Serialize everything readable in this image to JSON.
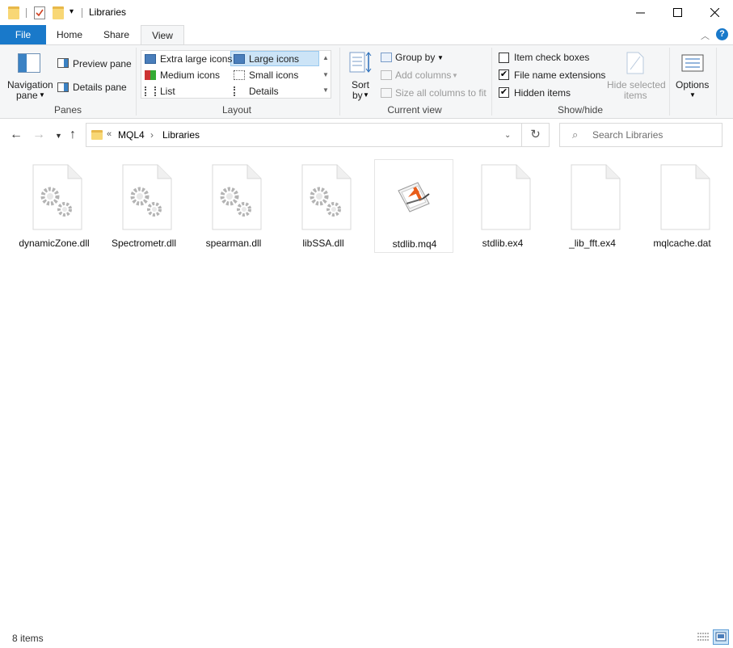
{
  "window": {
    "title": "Libraries"
  },
  "tabs": [
    "File",
    "Home",
    "Share",
    "View"
  ],
  "ribbon": {
    "panes": {
      "nav_pane_l1": "Navigation",
      "nav_pane_l2": "pane",
      "preview": "Preview pane",
      "details": "Details pane",
      "label": "Panes"
    },
    "layout": {
      "items": [
        "Extra large icons",
        "Large icons",
        "Medium icons",
        "Small icons",
        "List",
        "Details"
      ],
      "selected": "Large icons",
      "label": "Layout"
    },
    "current_view": {
      "sort_l1": "Sort",
      "sort_l2": "by",
      "group_by": "Group by",
      "add_columns": "Add columns",
      "size_columns": "Size all columns to fit",
      "label": "Current view"
    },
    "show_hide": {
      "item_check_boxes": "Item check boxes",
      "file_name_extensions": "File name extensions",
      "hidden_items": "Hidden items",
      "hide_selected_l1": "Hide selected",
      "hide_selected_l2": "items",
      "label": "Show/hide",
      "checked": {
        "item_check_boxes": false,
        "file_name_extensions": true,
        "hidden_items": true
      }
    },
    "options": {
      "label": "Options"
    }
  },
  "address": {
    "overflow": "«",
    "crumbs": [
      "MQL4",
      "Libraries"
    ]
  },
  "search": {
    "placeholder": "Search Libraries"
  },
  "files": [
    {
      "name": "dynamicZone.dll",
      "icon": "gears-icon"
    },
    {
      "name": "Spectrometr.dll",
      "icon": "gears-icon"
    },
    {
      "name": "spearman.dll",
      "icon": "gears-icon"
    },
    {
      "name": "libSSA.dll",
      "icon": "gears-icon"
    },
    {
      "name": "stdlib.mq4",
      "icon": "metaeditor-icon"
    },
    {
      "name": "stdlib.ex4",
      "icon": "blank-file-icon"
    },
    {
      "name": "_lib_fft.ex4",
      "icon": "blank-file-icon"
    },
    {
      "name": "mqlcache.dat",
      "icon": "blank-file-icon"
    }
  ],
  "status": {
    "count": "8 items"
  },
  "colors": {
    "file_tab": "#1979ca",
    "selection": "#cce4f7",
    "folder": "#f8d775"
  }
}
